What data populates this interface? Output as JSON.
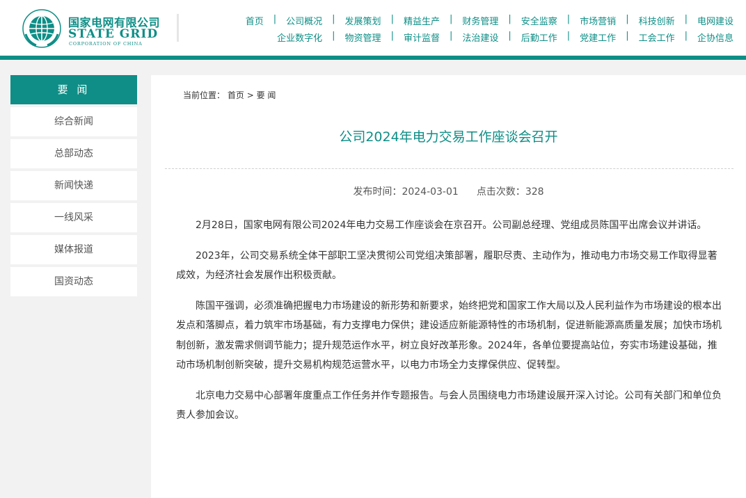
{
  "brand": {
    "name_cn": "国家电网有限公司",
    "name_en": "STATE GRID",
    "name_sub": "CORPORATION OF CHINA",
    "color": "#0e8e86",
    "emblem_icon": "state-grid-globe-icon"
  },
  "nav": {
    "row1": [
      "首页",
      "公司概况",
      "发展策划",
      "精益生产",
      "财务管理",
      "安全监察",
      "市场营销",
      "科技创新",
      "电网建设"
    ],
    "row2": [
      "企业数字化",
      "物资管理",
      "审计监督",
      "法治建设",
      "后勤工作",
      "党建工作",
      "工会工作",
      "企协信息"
    ],
    "separator": "|"
  },
  "sidebar": {
    "title": "要 闻",
    "items": [
      {
        "label": "综合新闻"
      },
      {
        "label": "总部动态"
      },
      {
        "label": "新闻快递"
      },
      {
        "label": "一线风采"
      },
      {
        "label": "媒体报道"
      },
      {
        "label": "国资动态"
      }
    ]
  },
  "breadcrumb": {
    "prefix": "当前位置：",
    "home": "首页",
    "sep": ">",
    "current": "要 闻"
  },
  "article": {
    "title": "公司2024年电力交易工作座谈会召开",
    "publish_label": "发布时间：",
    "publish_date": "2024-03-01",
    "views_label": "点击次数：",
    "views": "328",
    "paragraphs": [
      "2月28日，国家电网有限公司2024年电力交易工作座谈会在京召开。公司副总经理、党组成员陈国平出席会议并讲话。",
      "2023年，公司交易系统全体干部职工坚决贯彻公司党组决策部署，履职尽责、主动作为，推动电力市场交易工作取得显著成效，为经济社会发展作出积极贡献。",
      "陈国平强调，必须准确把握电力市场建设的新形势和新要求，始终把党和国家工作大局以及人民利益作为市场建设的根本出发点和落脚点，着力筑牢市场基础，有力支撑电力保供；建设适应新能源特性的市场机制，促进新能源高质量发展；加快市场机制创新，激发需求侧调节能力；提升规范运作水平，树立良好改革形象。2024年，各单位要提高站位，夯实市场建设基础，推动市场机制创新突破，提升交易机构规范运营水平，以电力市场全力支撑保供应、促转型。",
      "北京电力交易中心部署年度重点工作任务并作专题报告。与会人员围绕电力市场建设展开深入讨论。公司有关部门和单位负责人参加会议。"
    ]
  }
}
